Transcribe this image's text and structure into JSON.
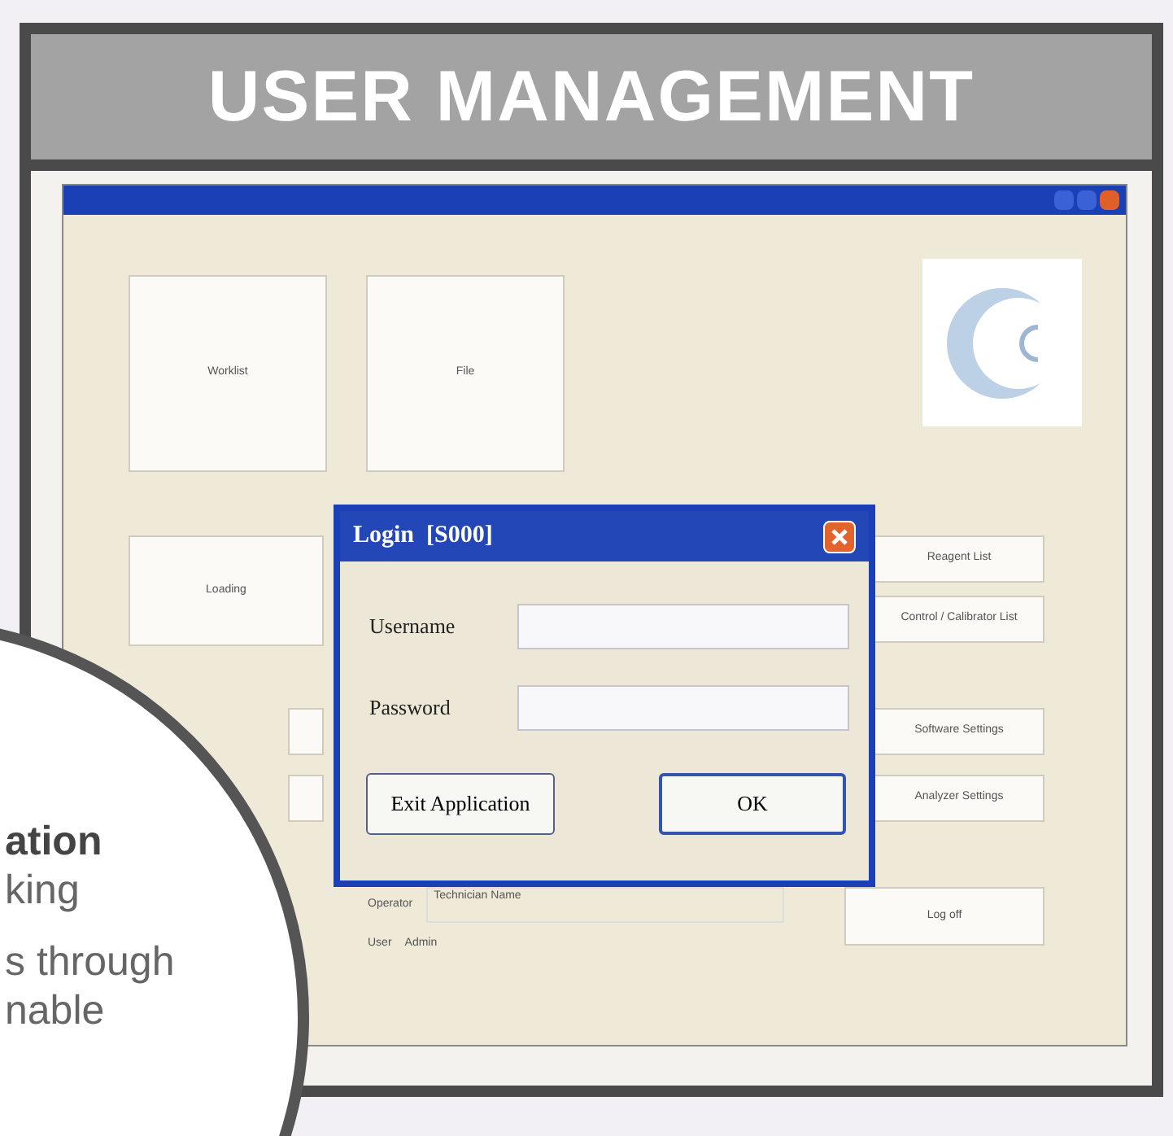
{
  "header": {
    "title": "USER MANAGEMENT"
  },
  "app": {
    "tiles": [
      "Worklist",
      "File"
    ],
    "side_button": "Loading",
    "right_buttons": [
      "Reagent List",
      "Control / Calibrator List"
    ],
    "right_buttons_lower": [
      "Software Settings",
      "Analyzer Settings"
    ],
    "technician": {
      "label": "Operator",
      "value": "Technician Name"
    },
    "user": {
      "label": "User",
      "value": "Admin"
    },
    "logoff": "Log off"
  },
  "dialog": {
    "title": "Login  [S000]",
    "fields": [
      {
        "label": "Username"
      },
      {
        "label": "Password"
      }
    ],
    "buttons": [
      {
        "label": "Exit Application",
        "kind": "plain"
      },
      {
        "label": "OK",
        "kind": "default"
      }
    ]
  },
  "overlay": {
    "lines": [
      {
        "text": "ation",
        "kind": "heading"
      },
      {
        "text": "king",
        "kind": "body"
      },
      {
        "text": "s through",
        "kind": "body"
      },
      {
        "text": "nable",
        "kind": "body"
      }
    ]
  }
}
